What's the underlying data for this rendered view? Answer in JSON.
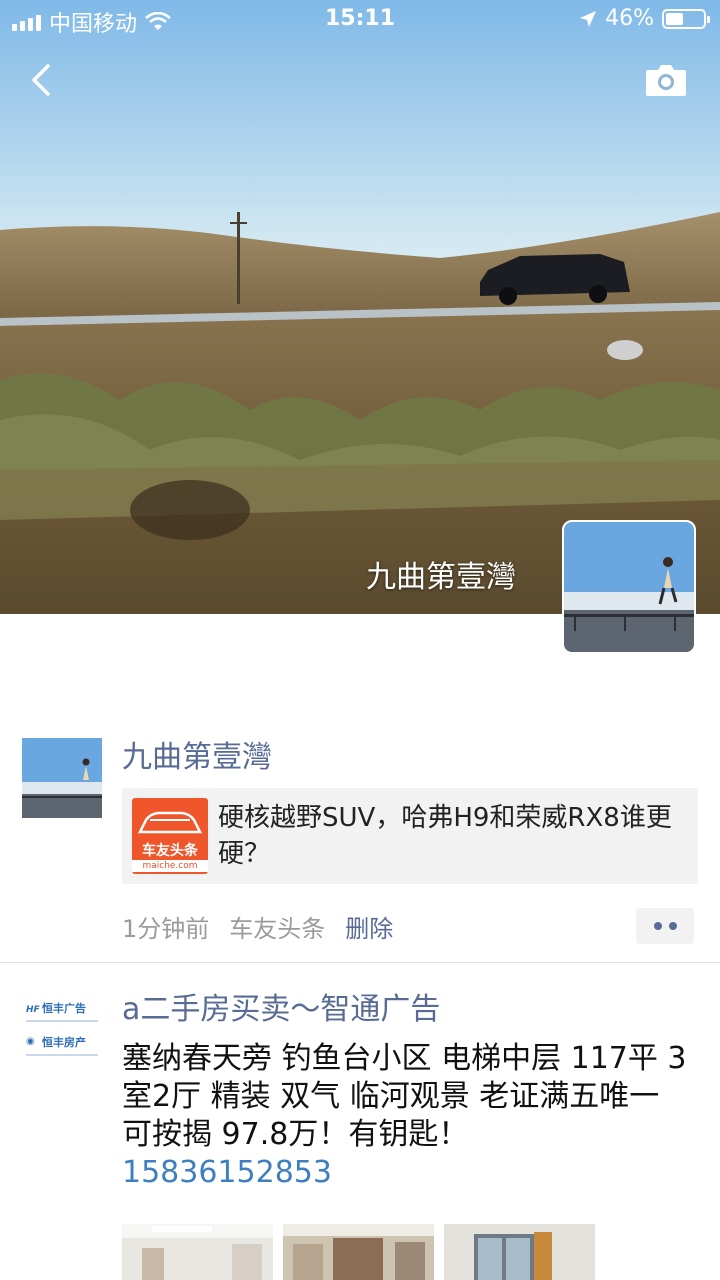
{
  "status_bar": {
    "carrier": "中国移动",
    "time": "15:11",
    "battery_percent": "46%",
    "battery_level": 0.46
  },
  "cover": {
    "name": "九曲第壹灣"
  },
  "posts": [
    {
      "name": "九曲第壹灣",
      "share": {
        "thumb_brand": "车友头条",
        "thumb_domain": "maiche.com",
        "title": "硬核越野SUV，哈弗H9和荣威RX8谁更硬？"
      },
      "time": "1分钟前",
      "source": "车友头条",
      "delete": "删除"
    },
    {
      "name": "a二手房买卖～智通广告",
      "text": "塞纳春天旁 钓鱼台小区 电梯中层  117平  3室2厅  精装  双气  临河观景  老证满五唯一  可按揭 97.8万！有钥匙！",
      "phone": "15836152853",
      "avatar_lines": [
        "恒丰广告",
        "恒丰房产"
      ]
    }
  ],
  "icons": {
    "back": "chevron-left-icon",
    "camera": "camera-icon",
    "wifi": "wifi-icon",
    "location": "location-arrow-icon",
    "more": "more-dots-icon"
  },
  "colors": {
    "link": "#586b95",
    "phone": "#3f7fc0",
    "meta": "#9b9b9b",
    "brand_orange": "#f0562b"
  }
}
